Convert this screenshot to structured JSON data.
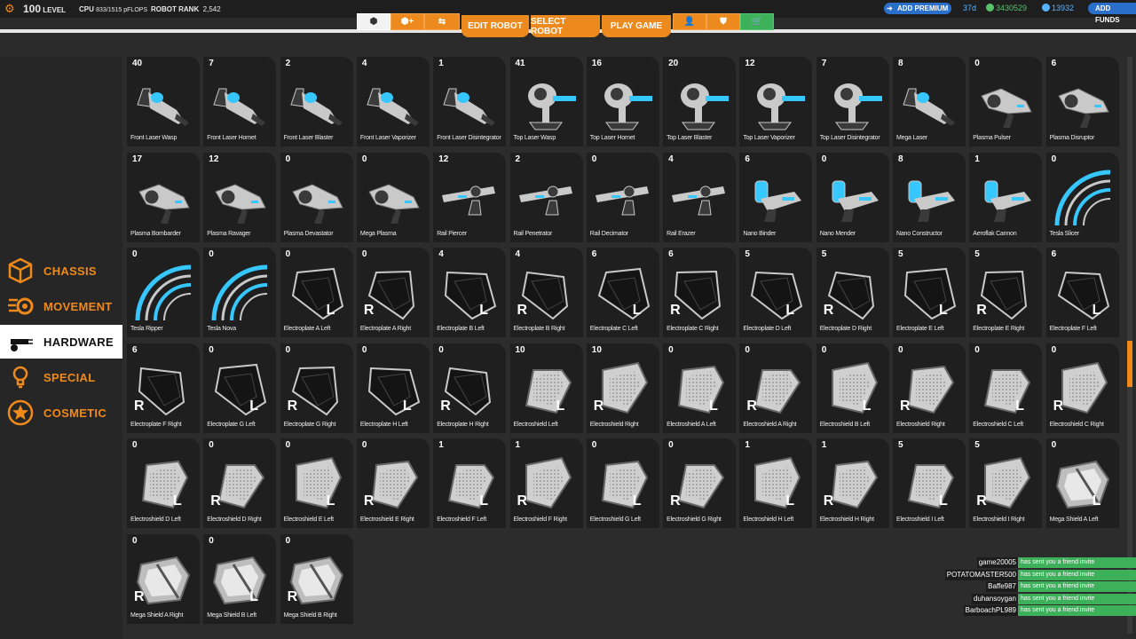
{
  "topbar": {
    "level": "100",
    "level_label": "LEVEL",
    "cpu_label": "CPU",
    "cpu_value": "833/1515 pFLOPS",
    "rank_label": "ROBOT RANK",
    "rank_value": "2,542",
    "premium_label": "ADD PREMIUM",
    "premium_days": "37d",
    "robits": "3430529",
    "cosmetic_credits": "13932",
    "funds_label": "ADD FUNDS"
  },
  "nav": {
    "edit_robot": "EDIT ROBOT",
    "select_robot": "SELECT ROBOT",
    "play_game": "PLAY GAME"
  },
  "sidebar": {
    "items": [
      {
        "label": "CHASSIS",
        "icon": "cube-icon"
      },
      {
        "label": "MOVEMENT",
        "icon": "wheel-icon"
      },
      {
        "label": "HARDWARE",
        "icon": "laser-icon"
      },
      {
        "label": "SPECIAL",
        "icon": "bulb-icon"
      },
      {
        "label": "COSMETIC",
        "icon": "star-icon"
      }
    ],
    "active": "HARDWARE"
  },
  "items": [
    {
      "count": "40",
      "name": "Front Laser Wasp",
      "type": "gun"
    },
    {
      "count": "7",
      "name": "Front Laser Hornet",
      "type": "gun"
    },
    {
      "count": "2",
      "name": "Front Laser Blaster",
      "type": "gun"
    },
    {
      "count": "4",
      "name": "Front Laser Vaporizer",
      "type": "gun"
    },
    {
      "count": "1",
      "name": "Front Laser Disintegrator",
      "type": "gun"
    },
    {
      "count": "41",
      "name": "Top Laser Wasp",
      "type": "turret"
    },
    {
      "count": "16",
      "name": "Top Laser Hornet",
      "type": "turret"
    },
    {
      "count": "20",
      "name": "Top Laser Blaster",
      "type": "turret"
    },
    {
      "count": "12",
      "name": "Top Laser Vaporizer",
      "type": "turret"
    },
    {
      "count": "7",
      "name": "Top Laser Disintegrator",
      "type": "turret"
    },
    {
      "count": "8",
      "name": "Mega Laser",
      "type": "gun"
    },
    {
      "count": "0",
      "name": "Plasma Pulser",
      "type": "plasma"
    },
    {
      "count": "6",
      "name": "Plasma Disruptor",
      "type": "plasma"
    },
    {
      "count": "17",
      "name": "Plasma Bombarder",
      "type": "plasma"
    },
    {
      "count": "12",
      "name": "Plasma Ravager",
      "type": "plasma"
    },
    {
      "count": "0",
      "name": "Plasma Devastator",
      "type": "plasma"
    },
    {
      "count": "0",
      "name": "Mega Plasma",
      "type": "plasma"
    },
    {
      "count": "12",
      "name": "Rail Piercer",
      "type": "rail"
    },
    {
      "count": "2",
      "name": "Rail Penetrator",
      "type": "rail"
    },
    {
      "count": "0",
      "name": "Rail Decimator",
      "type": "rail"
    },
    {
      "count": "4",
      "name": "Rail Erazer",
      "type": "rail"
    },
    {
      "count": "6",
      "name": "Nano Binder",
      "type": "nano"
    },
    {
      "count": "0",
      "name": "Nano Mender",
      "type": "nano"
    },
    {
      "count": "8",
      "name": "Nano Constructor",
      "type": "nano"
    },
    {
      "count": "1",
      "name": "Aeroflak Cannon",
      "type": "nano"
    },
    {
      "count": "0",
      "name": "Tesla Slicer",
      "type": "tesla"
    },
    {
      "count": "0",
      "name": "Tesla Ripper",
      "type": "tesla"
    },
    {
      "count": "0",
      "name": "Tesla Nova",
      "type": "tesla"
    },
    {
      "count": "0",
      "name": "Electroplate A Left",
      "type": "plate",
      "side": "L"
    },
    {
      "count": "0",
      "name": "Electroplate A Right",
      "type": "plate",
      "side": "R"
    },
    {
      "count": "4",
      "name": "Electroplate B Left",
      "type": "plate",
      "side": "L"
    },
    {
      "count": "4",
      "name": "Electroplate B Right",
      "type": "plate",
      "side": "R"
    },
    {
      "count": "6",
      "name": "Electroplate C Left",
      "type": "plate",
      "side": "L"
    },
    {
      "count": "6",
      "name": "Electroplate C Right",
      "type": "plate",
      "side": "R"
    },
    {
      "count": "5",
      "name": "Electroplate D Left",
      "type": "plate",
      "side": "L"
    },
    {
      "count": "5",
      "name": "Electroplate D Right",
      "type": "plate",
      "side": "R"
    },
    {
      "count": "5",
      "name": "Electroplate E Left",
      "type": "plate",
      "side": "L"
    },
    {
      "count": "5",
      "name": "Electroplate E Right",
      "type": "plate",
      "side": "R"
    },
    {
      "count": "6",
      "name": "Electroplate F Left",
      "type": "plate",
      "side": "L"
    },
    {
      "count": "6",
      "name": "Electroplate F Right",
      "type": "plate",
      "side": "R"
    },
    {
      "count": "0",
      "name": "Electroplate G Left",
      "type": "plate",
      "side": "L"
    },
    {
      "count": "0",
      "name": "Electroplate G Right",
      "type": "plate",
      "side": "R"
    },
    {
      "count": "0",
      "name": "Electroplate H Left",
      "type": "plate",
      "side": "L"
    },
    {
      "count": "0",
      "name": "Electroplate H Right",
      "type": "plate",
      "side": "R"
    },
    {
      "count": "10",
      "name": "Electroshield Left",
      "type": "shield",
      "side": "L"
    },
    {
      "count": "10",
      "name": "Electroshield Right",
      "type": "shield",
      "side": "R"
    },
    {
      "count": "0",
      "name": "Electroshield A Left",
      "type": "shield",
      "side": "L"
    },
    {
      "count": "0",
      "name": "Electroshield A Right",
      "type": "shield",
      "side": "R"
    },
    {
      "count": "0",
      "name": "Electroshield B Left",
      "type": "shield",
      "side": "L"
    },
    {
      "count": "0",
      "name": "Electroshield Right",
      "type": "shield",
      "side": "R"
    },
    {
      "count": "0",
      "name": "Electroshield C Left",
      "type": "shield",
      "side": "L"
    },
    {
      "count": "0",
      "name": "Electroshield C Right",
      "type": "shield",
      "side": "R"
    },
    {
      "count": "0",
      "name": "Electroshield D Left",
      "type": "shield",
      "side": "L"
    },
    {
      "count": "0",
      "name": "Electroshield D Right",
      "type": "shield",
      "side": "R"
    },
    {
      "count": "0",
      "name": "Electroshield E Left",
      "type": "shield",
      "side": "L"
    },
    {
      "count": "0",
      "name": "Electroshield E Right",
      "type": "shield",
      "side": "R"
    },
    {
      "count": "1",
      "name": "Electroshield F Left",
      "type": "shield",
      "side": "L"
    },
    {
      "count": "1",
      "name": "Electroshield F Right",
      "type": "shield",
      "side": "R"
    },
    {
      "count": "0",
      "name": "Electroshield G Left",
      "type": "shield",
      "side": "L"
    },
    {
      "count": "0",
      "name": "Electroshield G Right",
      "type": "shield",
      "side": "R"
    },
    {
      "count": "1",
      "name": "Electroshield H Left",
      "type": "shield",
      "side": "L"
    },
    {
      "count": "1",
      "name": "Electroshield H Right",
      "type": "shield",
      "side": "R"
    },
    {
      "count": "5",
      "name": "Electroshield I Left",
      "type": "shield",
      "side": "L"
    },
    {
      "count": "5",
      "name": "Electroshield I Right",
      "type": "shield",
      "side": "R"
    },
    {
      "count": "0",
      "name": "Mega Shield A Left",
      "type": "mega",
      "side": "L"
    },
    {
      "count": "0",
      "name": "Mega Shield A Right",
      "type": "mega",
      "side": "R"
    },
    {
      "count": "0",
      "name": "Mega Shield B Left",
      "type": "mega",
      "side": "L"
    },
    {
      "count": "0",
      "name": "Mega Shield B Right",
      "type": "mega",
      "side": "R"
    }
  ],
  "notifications": [
    {
      "user": "game20005",
      "text": "has sent you a friend invite"
    },
    {
      "user": "POTATOMASTER500",
      "text": "has sent you a friend invite"
    },
    {
      "user": "Baffe987",
      "text": "has sent you a friend invite"
    },
    {
      "user": "duhansoygan",
      "text": "has sent you a friend invite"
    },
    {
      "user": "BarboachPL989",
      "text": "has sent you a friend invite"
    }
  ]
}
